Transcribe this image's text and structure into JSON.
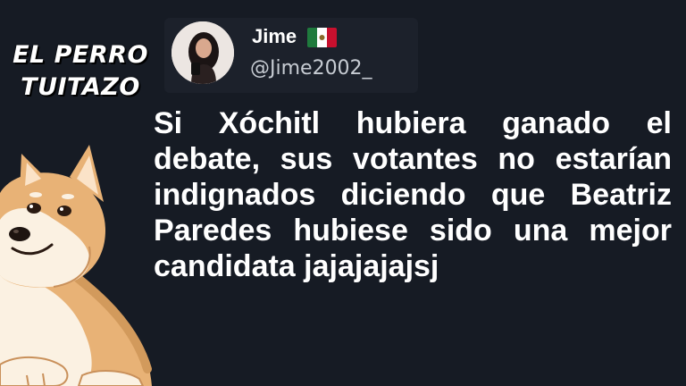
{
  "brand": {
    "line1": "EL PERRO",
    "line2": "TUITAZO"
  },
  "profile": {
    "name": "Jime",
    "handle": "@Jime2002_",
    "flag_icon": "mexico-flag-icon",
    "avatar_icon": "profile-photo-icon"
  },
  "tweet": {
    "text": "Si Xóchitl hubiera ganado el debate, sus votantes no estarían indignados diciendo que Beatriz Paredes hubiese sido una mejor candidata jajajajajsj"
  },
  "colors": {
    "background": "#161b24",
    "text": "#ffffff",
    "handle": "#c7ccd3",
    "flag_green": "#1f7a3d",
    "flag_white": "#ffffff",
    "flag_red": "#c8102e"
  },
  "mascot": {
    "icon": "shiba-dog-illustration"
  }
}
